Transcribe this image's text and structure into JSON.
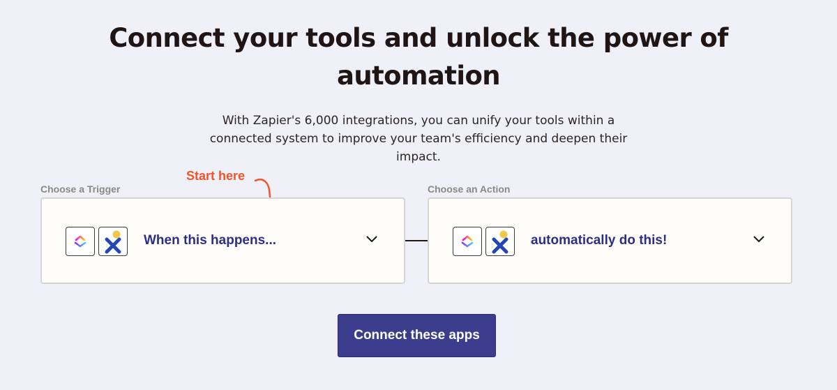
{
  "hero": {
    "title": "Connect your tools and unlock the power of automation",
    "subtitle": "With Zapier's 6,000 integrations, you can unify your tools within a connected system to improve your team's efficiency and deepen their impact."
  },
  "annotation": {
    "text": "Start here",
    "color": "#f0542a"
  },
  "trigger": {
    "label": "Choose a Trigger",
    "placeholder": "When this happens...",
    "apps": [
      "clickup-icon",
      "nextcloud-x-icon"
    ]
  },
  "action": {
    "label": "Choose an Action",
    "placeholder": "automatically do this!",
    "apps": [
      "clickup-icon",
      "nextcloud-x-icon"
    ]
  },
  "cta": {
    "label": "Connect these apps",
    "color": "#3d3d8d"
  },
  "colors": {
    "background": "#f0f1f8",
    "card_text": "#2d2e84",
    "section_label": "#8a8787"
  }
}
